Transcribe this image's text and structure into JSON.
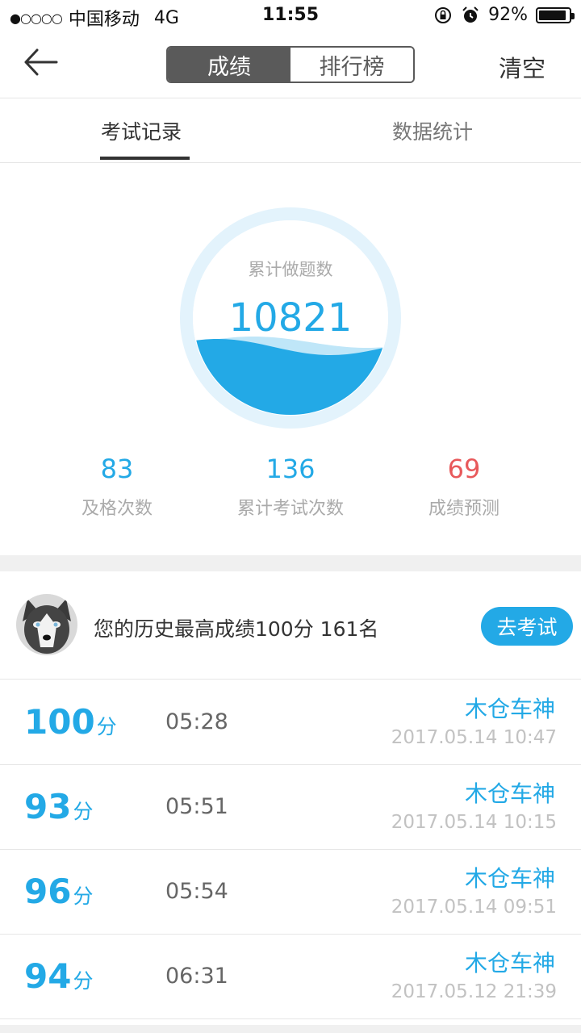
{
  "status_bar": {
    "signal": "●○○○○",
    "carrier": "中国移动",
    "network": "4G",
    "time": "11:55",
    "battery_percent": "92%",
    "battery_level": 0.92
  },
  "nav": {
    "back_icon": "back-arrow-icon",
    "segments": [
      "成绩",
      "排行榜"
    ],
    "active_segment": 0,
    "clear_label": "清空"
  },
  "tabs": {
    "items": [
      "考试记录",
      "数据统计"
    ],
    "active": 0
  },
  "gauge": {
    "label": "累计做题数",
    "value": "10821",
    "fill_level": 0.35,
    "ring_color": "#e3f3fc",
    "water_color": "#23a9e6"
  },
  "stats": [
    {
      "value": "83",
      "label": "及格次数"
    },
    {
      "value": "136",
      "label": "累计考试次数"
    },
    {
      "value": "69",
      "label": "成绩预测"
    }
  ],
  "best": {
    "text": "您的历史最高成绩100分 161名",
    "button": "去考试"
  },
  "records": [
    {
      "score": "100",
      "unit": "分",
      "duration": "05:28",
      "name": "木仓车神",
      "date": "2017.05.14 10:47"
    },
    {
      "score": "93",
      "unit": "分",
      "duration": "05:51",
      "name": "木仓车神",
      "date": "2017.05.14 10:15"
    },
    {
      "score": "96",
      "unit": "分",
      "duration": "05:54",
      "name": "木仓车神",
      "date": "2017.05.14 09:51"
    },
    {
      "score": "94",
      "unit": "分",
      "duration": "06:31",
      "name": "木仓车神",
      "date": "2017.05.12 21:39"
    }
  ],
  "colors": {
    "accent": "#23a9e6",
    "prediction": "#e8595b",
    "segment_dark": "#5a5a5a"
  }
}
